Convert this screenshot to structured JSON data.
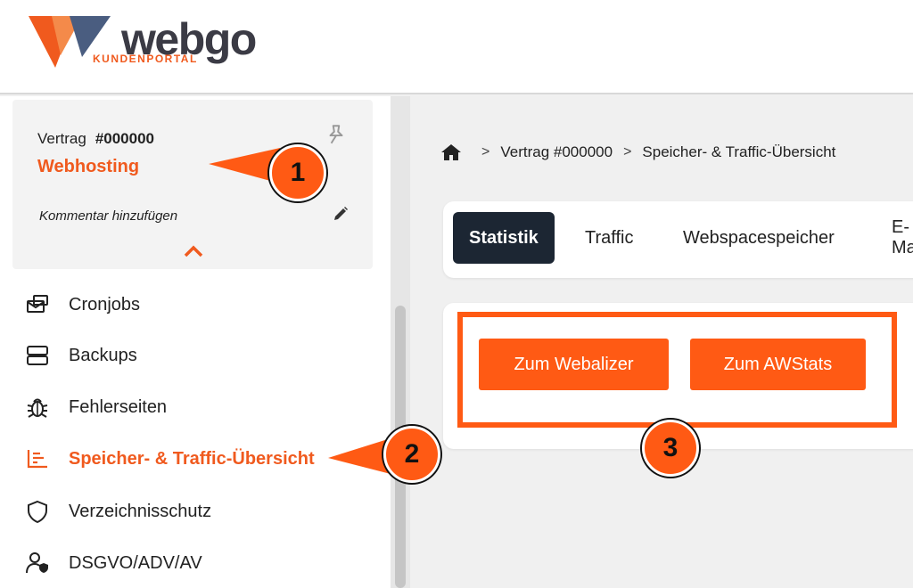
{
  "logo": {
    "word": "webgo",
    "sub": "KUNDENPORTAL"
  },
  "contract": {
    "label": "Vertrag",
    "number": "#000000",
    "type": "Webhosting",
    "comment": "Kommentar hinzufügen"
  },
  "nav": {
    "items": [
      {
        "label": "Cronjobs",
        "icon": "cronjob-icon"
      },
      {
        "label": "Backups",
        "icon": "server-icon"
      },
      {
        "label": "Fehlerseiten",
        "icon": "bug-icon"
      },
      {
        "label": "Speicher- & Traffic-Übersicht",
        "icon": "chart-icon",
        "active": true
      },
      {
        "label": "Verzeichnisschutz",
        "icon": "shield-icon"
      },
      {
        "label": "DSGVO/ADV/AV",
        "icon": "user-shield-icon"
      }
    ]
  },
  "breadcrumb": {
    "home_icon": "home-icon",
    "items": [
      "Vertrag #000000",
      "Speicher- & Traffic-Übersicht"
    ]
  },
  "tabs": [
    "Statistik",
    "Traffic",
    "Webspacespeicher",
    "E-Mail"
  ],
  "buttons": {
    "webalizer": "Zum Webalizer",
    "awstats": "Zum AWStats"
  },
  "callouts": [
    "1",
    "2",
    "3"
  ],
  "colors": {
    "accent": "#ff5a14",
    "brand_orange": "#f05a1e",
    "dark": "#1c2633"
  }
}
